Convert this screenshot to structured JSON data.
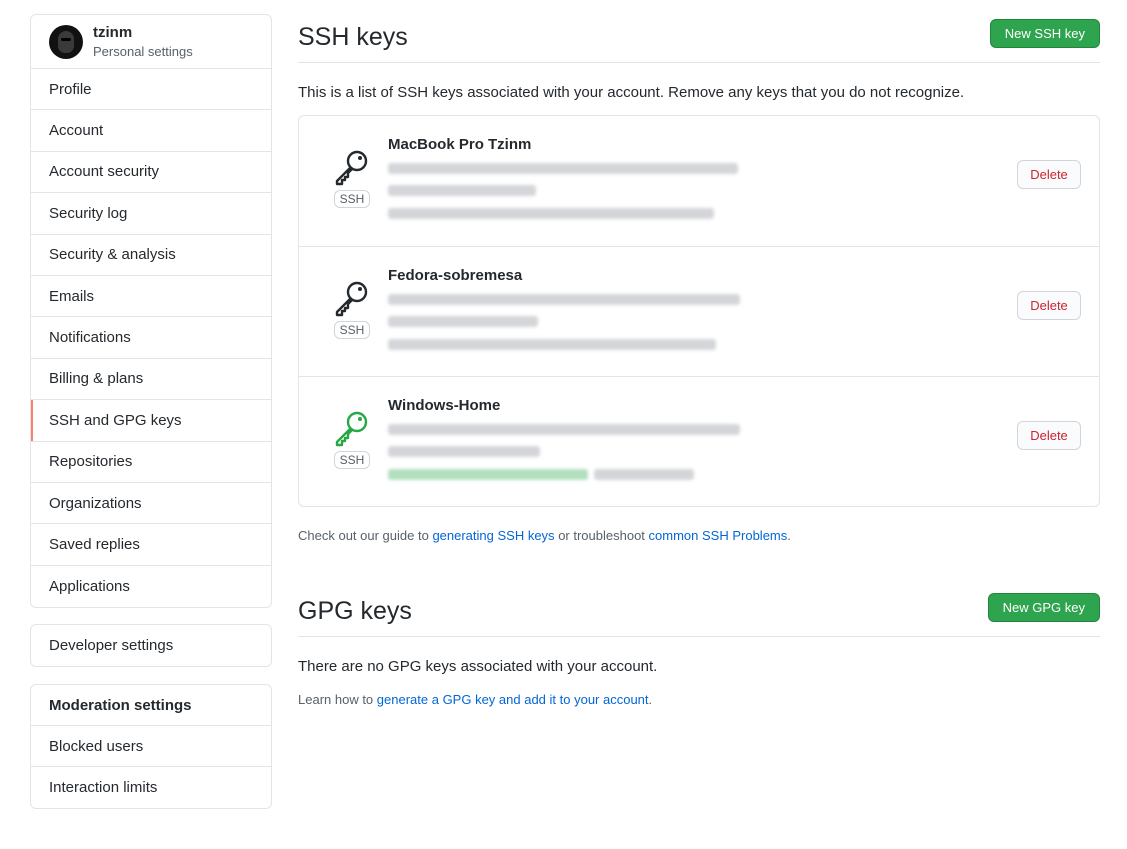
{
  "user": {
    "name": "tzinm",
    "subtitle": "Personal settings"
  },
  "sidebar": {
    "items": [
      {
        "label": "Profile"
      },
      {
        "label": "Account"
      },
      {
        "label": "Account security"
      },
      {
        "label": "Security log"
      },
      {
        "label": "Security & analysis"
      },
      {
        "label": "Emails"
      },
      {
        "label": "Notifications"
      },
      {
        "label": "Billing & plans"
      },
      {
        "label": "SSH and GPG keys",
        "selected": true
      },
      {
        "label": "Repositories"
      },
      {
        "label": "Organizations"
      },
      {
        "label": "Saved replies"
      },
      {
        "label": "Applications"
      }
    ],
    "developer": {
      "label": "Developer settings"
    },
    "moderation": {
      "heading": "Moderation settings",
      "items": [
        {
          "label": "Blocked users"
        },
        {
          "label": "Interaction limits"
        }
      ]
    }
  },
  "ssh": {
    "title": "SSH keys",
    "new_button": "New SSH key",
    "description": "This is a list of SSH keys associated with your account. Remove any keys that you do not recognize.",
    "keys": [
      {
        "title": "MacBook Pro Tzinm",
        "badge": "SSH",
        "delete_label": "Delete",
        "icon": "key-icon",
        "icon_color": "#24292e"
      },
      {
        "title": "Fedora-sobremesa",
        "badge": "SSH",
        "delete_label": "Delete",
        "icon": "key-icon",
        "icon_color": "#24292e"
      },
      {
        "title": "Windows-Home",
        "badge": "SSH",
        "delete_label": "Delete",
        "icon": "key-icon",
        "icon_color": "#28a745"
      }
    ],
    "help": {
      "prefix": "Check out our guide to",
      "link1": "generating SSH keys",
      "middle": "or troubleshoot",
      "link2": "common SSH Problems",
      "suffix": "."
    }
  },
  "gpg": {
    "title": "GPG keys",
    "new_button": "New GPG key",
    "empty_text": "There are no GPG keys associated with your account.",
    "help": {
      "prefix": "Learn how to",
      "link": "generate a GPG key and add it to your account",
      "suffix": "."
    }
  },
  "colors": {
    "accent_selected": "#f9826c",
    "primary_green": "#2ea44f",
    "link": "#0366d6",
    "danger": "#cb2431"
  }
}
